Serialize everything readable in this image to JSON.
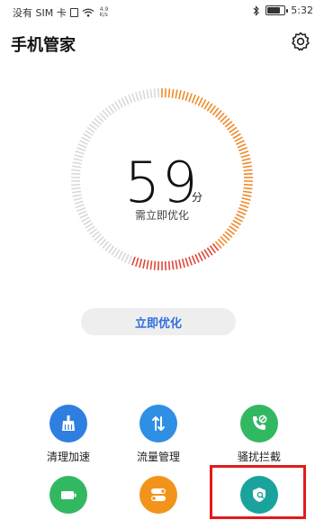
{
  "status_bar": {
    "carrier": "没有 SIM 卡",
    "sim_icon": "sim-card-icon",
    "net_speed_value": "4.9",
    "net_speed_unit": "K/s",
    "time": "5:32"
  },
  "header": {
    "title": "手机管家",
    "settings_icon": "gear-icon"
  },
  "score": {
    "value": "59",
    "unit": "分",
    "status": "需立即优化"
  },
  "optimize_button": {
    "label": "立即优化"
  },
  "tools": [
    {
      "label": "清理加速",
      "icon": "broom-icon",
      "color": "#2f7fe0"
    },
    {
      "label": "流量管理",
      "icon": "data-traffic-icon",
      "color": "#2f8fe5"
    },
    {
      "label": "骚扰拦截",
      "icon": "phone-block-icon",
      "color": "#33b862"
    },
    {
      "label": "",
      "icon": "battery-icon",
      "color": "#33b862"
    },
    {
      "label": "",
      "icon": "toggle-icon",
      "color": "#f2941b"
    },
    {
      "label": "",
      "icon": "security-scan-icon",
      "color": "#1aa39d"
    }
  ],
  "colors": {
    "accent_blue": "#2f6ee0",
    "gauge_orange": "#ef8a2a",
    "gauge_red": "#e0463a",
    "gauge_gray": "#d9d9d9",
    "highlight_red": "#e11a1a"
  }
}
